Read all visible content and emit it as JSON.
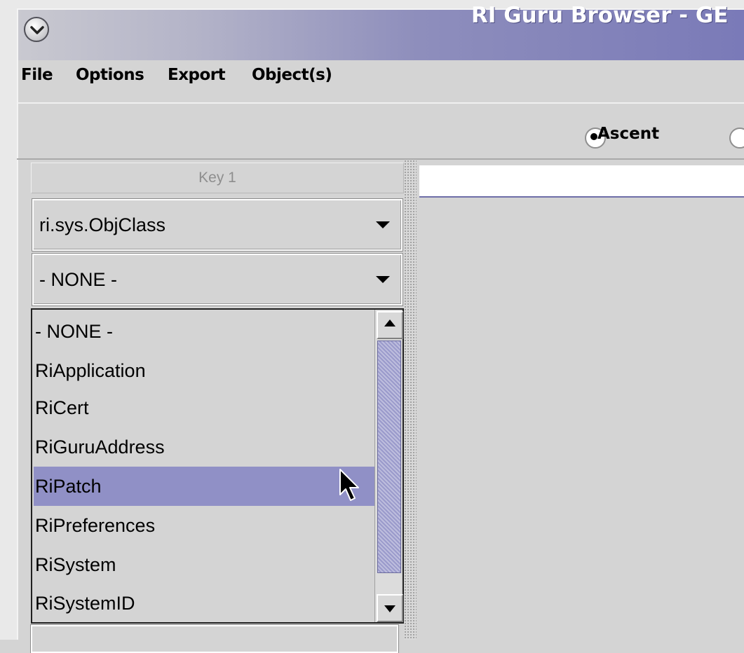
{
  "window": {
    "title": "RI Guru Browser - GE"
  },
  "menu": {
    "items": [
      {
        "label": "File"
      },
      {
        "label": "Options"
      },
      {
        "label": "Export"
      },
      {
        "label": "Object(s)"
      }
    ]
  },
  "toolbar": {
    "sort_options": [
      {
        "label": "Ascent",
        "selected": true
      },
      {
        "label": "",
        "selected": false
      }
    ]
  },
  "left_panel": {
    "header": "Key 1",
    "class_combo": {
      "value": "ri.sys.ObjClass"
    },
    "filter_combo": {
      "value": "- NONE -"
    },
    "dropdown_list": {
      "items": [
        "- NONE -",
        "RiApplication",
        "RiCert",
        "RiGuruAddress",
        "RiPatch",
        "RiPreferences",
        "RiSystem",
        "RiSystemID"
      ],
      "highlighted": "RiPatch"
    }
  },
  "colors": {
    "selection": "#9090c6",
    "title_gradient_end": "#7a7ab8",
    "background": "#d4d4d4"
  },
  "icons": {
    "window_menu": "chevron-down-icon",
    "pointer": "mouse-cursor-icon"
  }
}
